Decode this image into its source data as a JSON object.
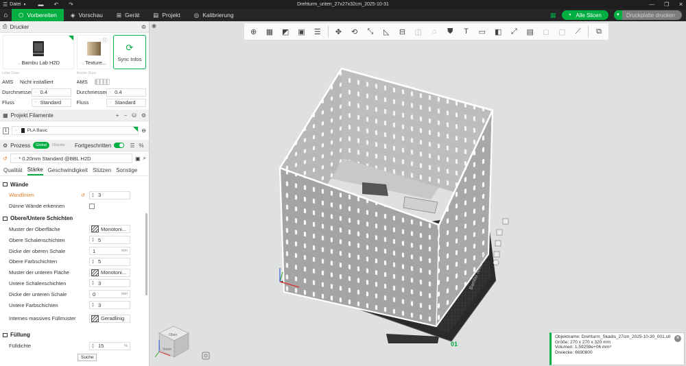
{
  "titlebar": {
    "menu_label": "Datei",
    "document_title": "Drehturm_unten_27x27x32cm_2025-10-31"
  },
  "nav": {
    "tabs": [
      {
        "label": "Vorbereiten",
        "icon": "cube-icon",
        "active": true
      },
      {
        "label": "Vorschau",
        "icon": "layers-icon",
        "active": false
      },
      {
        "label": "Gerät",
        "icon": "device-icon",
        "active": false
      },
      {
        "label": "Projekt",
        "icon": "folder-icon",
        "active": false
      },
      {
        "label": "Kalibrierung",
        "icon": "target-icon",
        "active": false
      }
    ],
    "slice_all": "Alle Slicen",
    "print_plate": "Druckplatte drucken"
  },
  "printer": {
    "section_title": "Drucker",
    "printer_name": "Bambu Lab H2D",
    "plate_type": "Texture...",
    "sync_label": "Sync Infos",
    "left_nozzle": "Linke Düse",
    "right_nozzle": "Rechte Düse",
    "left": {
      "ams_label": "AMS",
      "ams_value": "Nicht installiert",
      "diameter_label": "Durchmesser",
      "diameter_value": "0.4",
      "flow_label": "Fluss",
      "flow_value": "Standard"
    },
    "right": {
      "ams_label": "AMS",
      "diameter_label": "Durchmesser",
      "diameter_value": "0.4",
      "flow_label": "Fluss",
      "flow_value": "Standard"
    }
  },
  "filaments": {
    "section_title": "Projekt Filamente",
    "items": [
      {
        "index": "1",
        "name": "PLA Basic",
        "color": "#222222"
      }
    ]
  },
  "process": {
    "section_title": "Prozess",
    "toggle_global": "Global",
    "toggle_objects": "Objekte",
    "advanced_label": "Fortgeschritten",
    "preset": "* 0.20mm Standard @BBL H2D",
    "tabs": [
      "Qualität",
      "Stärke",
      "Geschwindigkeit",
      "Stützen",
      "Sonstige"
    ],
    "active_tab": "Stärke",
    "groups": {
      "walls": {
        "title": "Wände",
        "wall_loops_label": "Wandlinien",
        "wall_loops_value": "3",
        "thin_walls_label": "Dünne Wände erkennen"
      },
      "shells": {
        "title": "Obere/Untere Schichten",
        "top_pattern_label": "Muster der Oberfläche",
        "top_pattern_value": "Monotoni...",
        "top_layers_label": "Obere Schalenschichten",
        "top_layers_value": "5",
        "top_thickness_label": "Dicke der oberen Schale",
        "top_thickness_value": "1",
        "top_thickness_unit": "mm",
        "top_color_label": "Obere Farbschichten",
        "top_color_value": "5",
        "bottom_pattern_label": "Muster der unteren Fläche",
        "bottom_pattern_value": "Monotoni...",
        "bottom_layers_label": "Untere Schalenschichten",
        "bottom_layers_value": "3",
        "bottom_thickness_label": "Dicke der unteren Schale",
        "bottom_thickness_value": "0",
        "bottom_thickness_unit": "mm",
        "bottom_color_label": "Untere Farbschichten",
        "bottom_color_value": "3",
        "solid_infill_label": "Internes massives Füllmuster",
        "solid_infill_value": "Geradlinig"
      },
      "infill": {
        "title": "Füllung",
        "density_label": "Fülldichte",
        "density_value": "15",
        "density_unit": "%"
      }
    },
    "tooltip": "Suche"
  },
  "viewport": {
    "plate_number": "01",
    "plate_label": "Bambu Texture PEI",
    "nav_cube": {
      "top": "Oben",
      "front": "Vorne"
    }
  },
  "object_info": {
    "name_label": "Objektname:",
    "name_value": "Drehturm_Skadis_27cm_2025-10-30_001.stl",
    "size_label": "Größe:",
    "size_value": "270 x 270 x 320 mm",
    "volume_label": "Volumen:",
    "volume_value": "1.59259e+06 mm³",
    "triangles_label": "Dreiecke:",
    "triangles_value": "6690800"
  },
  "colors": {
    "accent": "#00ae42",
    "changed": "#e07c22",
    "bed_dark": "#3a3a3a",
    "object_grey": "#a8a8a8"
  }
}
